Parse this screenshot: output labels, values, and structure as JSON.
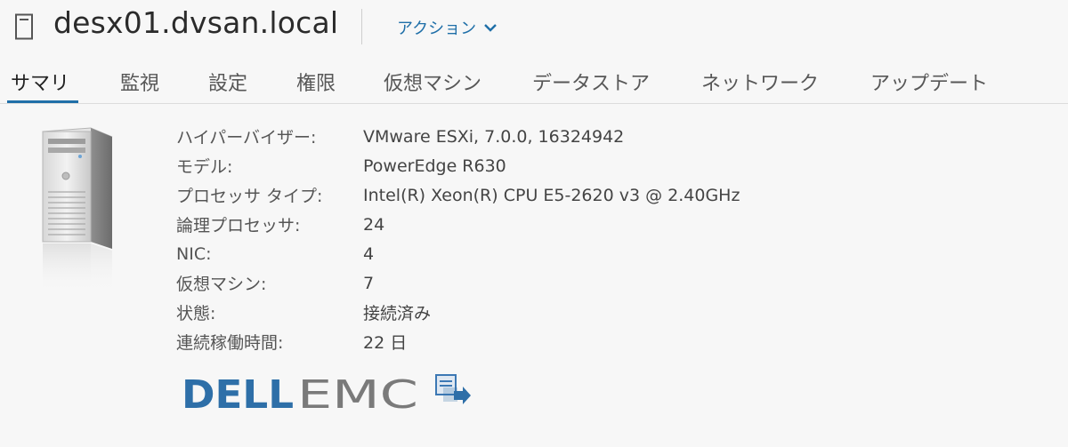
{
  "header": {
    "host_name": "desx01.dvsan.local",
    "actions_label": "アクション"
  },
  "tabs": [
    {
      "label": "サマリ",
      "active": true
    },
    {
      "label": "監視"
    },
    {
      "label": "設定"
    },
    {
      "label": "権限"
    },
    {
      "label": "仮想マシン"
    },
    {
      "label": "データストア"
    },
    {
      "label": "ネットワーク"
    },
    {
      "label": "アップデート"
    }
  ],
  "summary": {
    "rows": [
      {
        "label": "ハイパーバイザー:",
        "value": "VMware ESXi, 7.0.0, 16324942"
      },
      {
        "label": "モデル:",
        "value": "PowerEdge R630"
      },
      {
        "label": "プロセッサ タイプ:",
        "value": "Intel(R) Xeon(R) CPU E5-2620 v3 @ 2.40GHz"
      },
      {
        "label": "論理プロセッサ:",
        "value": "24"
      },
      {
        "label": "NIC:",
        "value": "4"
      },
      {
        "label": "仮想マシン:",
        "value": "7"
      },
      {
        "label": "状態:",
        "value": "接続済み"
      },
      {
        "label": "連続稼働時間:",
        "value": "22 日"
      }
    ]
  },
  "vendor_logo": {
    "brand": "DELLEMC",
    "dell_color": "#2e6fa8",
    "emc_color": "#7a7a7a"
  },
  "icons": {
    "host": "host-icon",
    "actions_chevron": "chevron-down-icon",
    "server": "server-tower-icon",
    "vendor_action": "vendor-tool-icon"
  },
  "colors": {
    "accent": "#1f6fa8"
  }
}
